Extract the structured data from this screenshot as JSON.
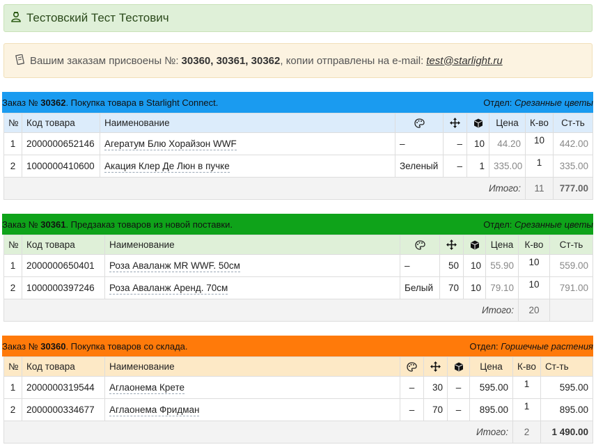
{
  "user": {
    "name": "Тестовский Тест Тестович",
    "icon": "user-icon"
  },
  "notice": {
    "icon": "receipt-icon",
    "prefix": "Вашим заказам присвоены №:",
    "numbers": "30360, 30361, 30362",
    "middle": ", копии отправлены на e-mail:",
    "email": "test@starlight.ru"
  },
  "columns": {
    "num": "№",
    "code": "Код товара",
    "name": "Наименование",
    "color_icon": "palette-icon",
    "size_icon": "move-icon",
    "pack_icon": "box-icon",
    "price": "Цена",
    "qty": "К-во",
    "cost": "Ст-ть"
  },
  "orders": [
    {
      "prefix": "Заказ №",
      "number": "30362",
      "desc": ". Покупка товара в Starlight Connect.",
      "dept_label": "Отдел:",
      "dept": "Срезанные цветы",
      "color": "#1a9bf0",
      "rows": [
        {
          "num": "1",
          "code": "2000000652146",
          "name": "Агератум Блю Хорайзон WWF",
          "color": "–",
          "size": "–",
          "pack": "10",
          "price": "44.20",
          "qty": "10",
          "cost": "442.00"
        },
        {
          "num": "2",
          "code": "1000000410600",
          "name": "Акация Клер Де Люн в пучке",
          "color": "Зеленый",
          "size": "–",
          "pack": "1",
          "price": "335.00",
          "qty": "1",
          "cost": "335.00"
        }
      ],
      "total_label": "Итого:",
      "total_qty": "11",
      "total_sum": "777.00"
    },
    {
      "prefix": "Заказ №",
      "number": "30361",
      "desc": ". Предзаказ товаров из новой поставки.",
      "dept_label": "Отдел:",
      "dept": "Срезанные цветы",
      "color": "#0fa31a",
      "rows": [
        {
          "num": "1",
          "code": "2000000650401",
          "name": "Роза Аваланж MR WWF. 50см",
          "color": "–",
          "size": "50",
          "pack": "10",
          "price": "55.90",
          "qty": "10",
          "cost": "559.00"
        },
        {
          "num": "2",
          "code": "1000000397246",
          "name": "Роза Аваланж Аренд. 70см",
          "color": "Белый",
          "size": "70",
          "pack": "10",
          "price": "79.10",
          "qty": "10",
          "cost": "791.00"
        }
      ],
      "total_label": "Итого:",
      "total_qty": "20",
      "total_sum": ""
    },
    {
      "prefix": "Заказ №",
      "number": "30360",
      "desc": ". Покупка товаров со склада.",
      "dept_label": "Отдел:",
      "dept": "Горшечные растения",
      "color": "#ff7a0a",
      "rows": [
        {
          "num": "1",
          "code": "2000000319544",
          "name": "Аглаонема Крете",
          "color": "–",
          "size": "30",
          "pack": "–",
          "price": "595.00",
          "qty": "1",
          "cost": "595.00"
        },
        {
          "num": "2",
          "code": "2000000334677",
          "name": "Аглаонема Фридман",
          "color": "–",
          "size": "70",
          "pack": "–",
          "price": "895.00",
          "qty": "1",
          "cost": "895.00"
        }
      ],
      "total_label": "Итого:",
      "total_qty": "2",
      "total_sum": "1 490.00"
    }
  ]
}
